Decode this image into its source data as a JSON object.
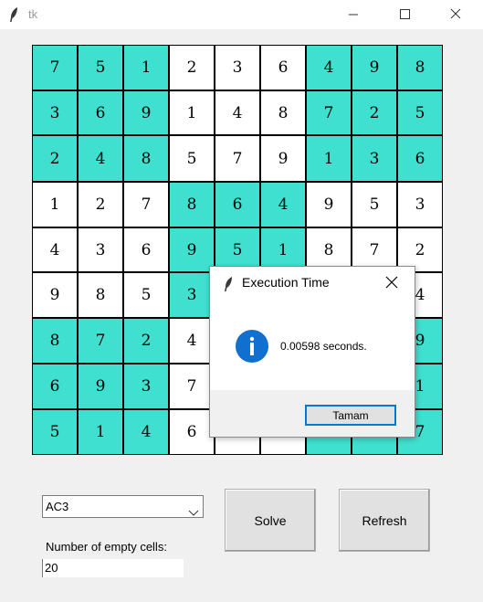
{
  "window": {
    "title": "tk",
    "icon": "feather-icon"
  },
  "sudoku": {
    "cells": [
      [
        7,
        5,
        1,
        2,
        3,
        6,
        4,
        9,
        8
      ],
      [
        3,
        6,
        9,
        1,
        4,
        8,
        7,
        2,
        5
      ],
      [
        2,
        4,
        8,
        5,
        7,
        9,
        1,
        3,
        6
      ],
      [
        1,
        2,
        7,
        8,
        6,
        4,
        9,
        5,
        3
      ],
      [
        4,
        3,
        6,
        9,
        5,
        1,
        8,
        7,
        2
      ],
      [
        9,
        8,
        5,
        3,
        null,
        null,
        null,
        null,
        4
      ],
      [
        8,
        7,
        2,
        4,
        null,
        null,
        null,
        null,
        9
      ],
      [
        6,
        9,
        3,
        7,
        null,
        null,
        null,
        null,
        1
      ],
      [
        5,
        1,
        4,
        6,
        null,
        null,
        null,
        null,
        7
      ]
    ],
    "colors": {
      "teal": "#40e0d0",
      "white": "#ffffff"
    }
  },
  "controls": {
    "algorithm_select": {
      "value": "AC3"
    },
    "solve_label": "Solve",
    "refresh_label": "Refresh",
    "empty_cells_label": "Number of empty cells:",
    "empty_cells_value": "20"
  },
  "dialog": {
    "title": "Execution Time",
    "message": "0.00598 seconds.",
    "ok_label": "Tamam",
    "icon": "info-icon"
  }
}
